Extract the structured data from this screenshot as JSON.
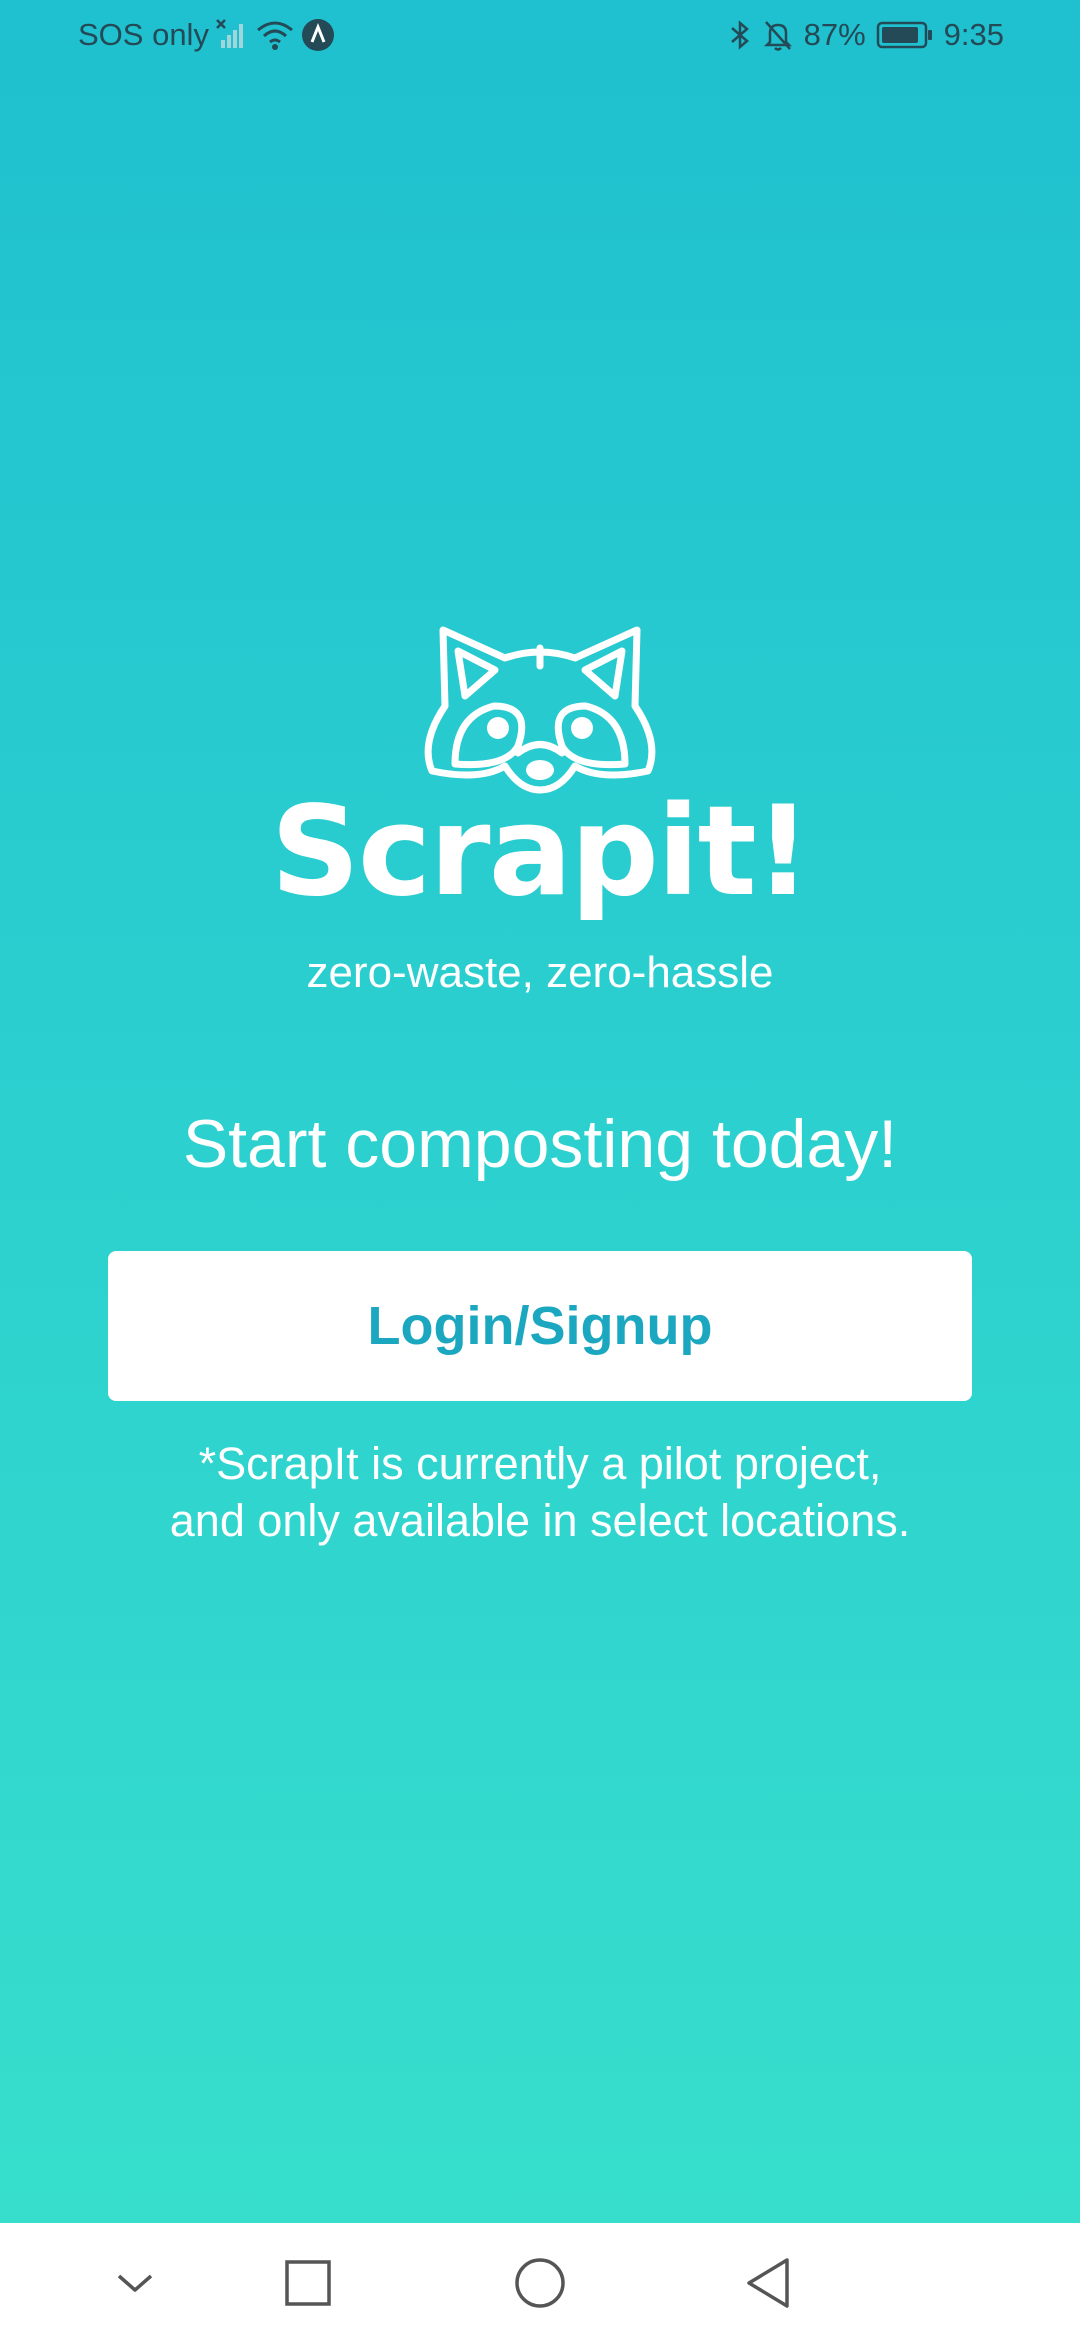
{
  "status_bar": {
    "carrier": "SOS only",
    "battery_percent": "87%",
    "time": "9:35",
    "icons": [
      "signal-x-icon",
      "wifi-icon",
      "navigation-icon",
      "bluetooth-icon",
      "bell-off-icon",
      "battery-icon"
    ]
  },
  "app": {
    "name": "Scrapit!",
    "tagline": "zero-waste, zero-hassle",
    "logo_icon": "raccoon-icon"
  },
  "main": {
    "headline": "Start composting today!",
    "login_button": "Login/Signup",
    "disclaimer": "*ScrapIt is currently a pilot project, and only available in select locations."
  },
  "nav_bar": {
    "icons": [
      "chevron-down-icon",
      "square-recents-icon",
      "circle-home-icon",
      "triangle-back-icon"
    ]
  },
  "colors": {
    "gradient_top": "#1fc0cf",
    "gradient_bottom": "#38e0cc",
    "accent": "#1ba7bf"
  }
}
